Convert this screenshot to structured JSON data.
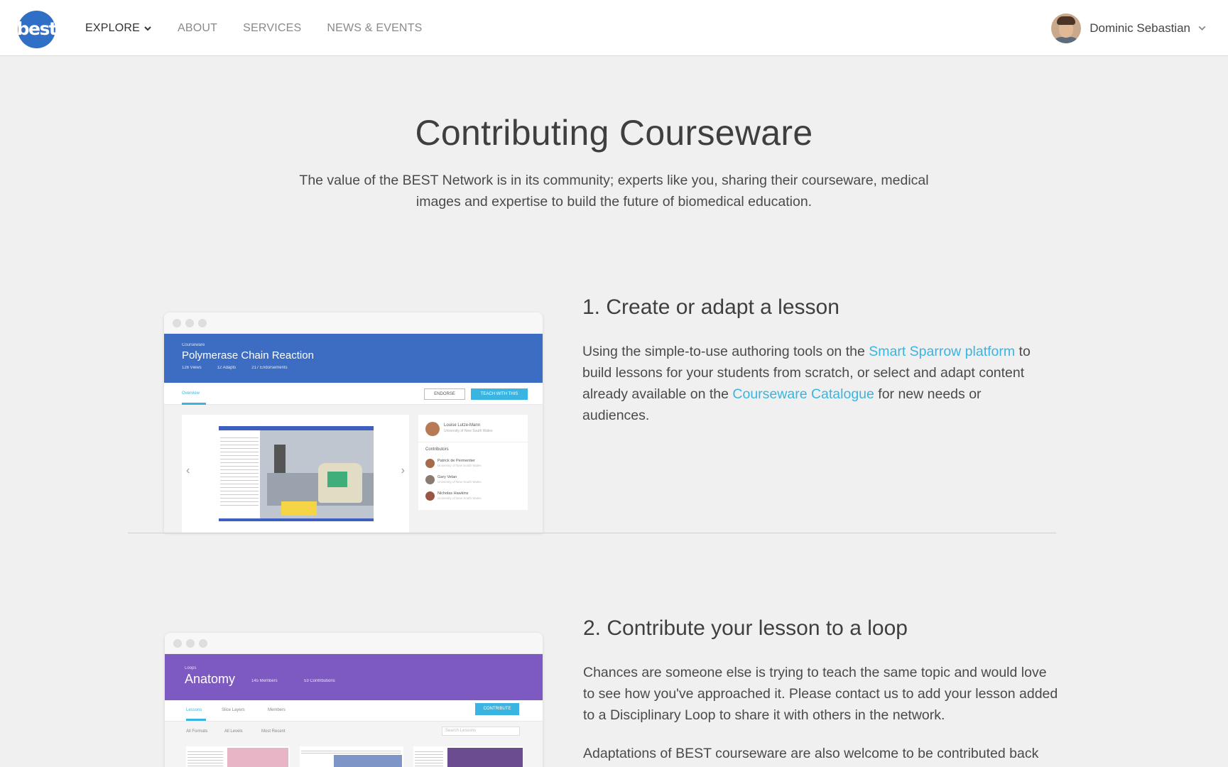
{
  "nav": {
    "logo_text": "best",
    "links": [
      "EXPLORE",
      "ABOUT",
      "SERVICES",
      "NEWS & EVENTS"
    ],
    "user_name": "Dominic Sebastian"
  },
  "hero": {
    "title": "Contributing Courseware",
    "subtitle": "The value of the BEST Network is in its community; experts like you, sharing their courseware, medical images and expertise to build the future of biomedical education."
  },
  "section1": {
    "heading": "1. Create or adapt a lesson",
    "text_1": "Using the simple-to-use authoring tools on the ",
    "link_1": "Smart Sparrow platform",
    "text_2": " to build lessons for your students from scratch, or select and adapt content already available on the ",
    "link_2": "Courseware Catalogue",
    "text_3": " for new needs or audiences.",
    "mock": {
      "eyebrow": "Courseware",
      "title": "Polymerase Chain Reaction",
      "stats": [
        "126 Views",
        "12 Adapts",
        "217 Endorsements"
      ],
      "tab": "Overview",
      "endorse": "ENDORSE",
      "teach": "TEACH WITH THIS",
      "author_name": "Louise Lutze-Mann",
      "author_org": "University of New South Wales",
      "contributors_label": "Contributors",
      "contributors": [
        {
          "name": "Patrick de Permentier",
          "org": "University of New South Wales"
        },
        {
          "name": "Gary Velan",
          "org": "University of New South Wales"
        },
        {
          "name": "Nicholas Hawkins",
          "org": "University of New South Wales"
        }
      ]
    }
  },
  "section2": {
    "heading": "2. Contribute your lesson to a loop",
    "para_1": "Chances are someone else is trying to teach the same topic and would love to see how you've approached it. Please contact us to add your lesson added to a Disciplinary Loop to share it with others in the network.",
    "para_2": "Adaptations of BEST courseware are also welcome to be contributed back",
    "mock": {
      "eyebrow": "Loops",
      "title": "Anatomy",
      "members": "145 Members",
      "contributions": "53 Contributions",
      "contribute": "CONTRIBUTE",
      "tabs": [
        "Lessons",
        "Slice Layers",
        "Members"
      ],
      "filters": [
        "All Formats",
        "All Levels",
        "Most Recent"
      ],
      "search_placeholder": "Search Lessons"
    }
  },
  "colors": {
    "accent_link": "#3ab4e0",
    "logo_blue": "#2f6fc6",
    "pcr_blue": "#3d6dc2",
    "anatomy_purple": "#7d59c2"
  }
}
